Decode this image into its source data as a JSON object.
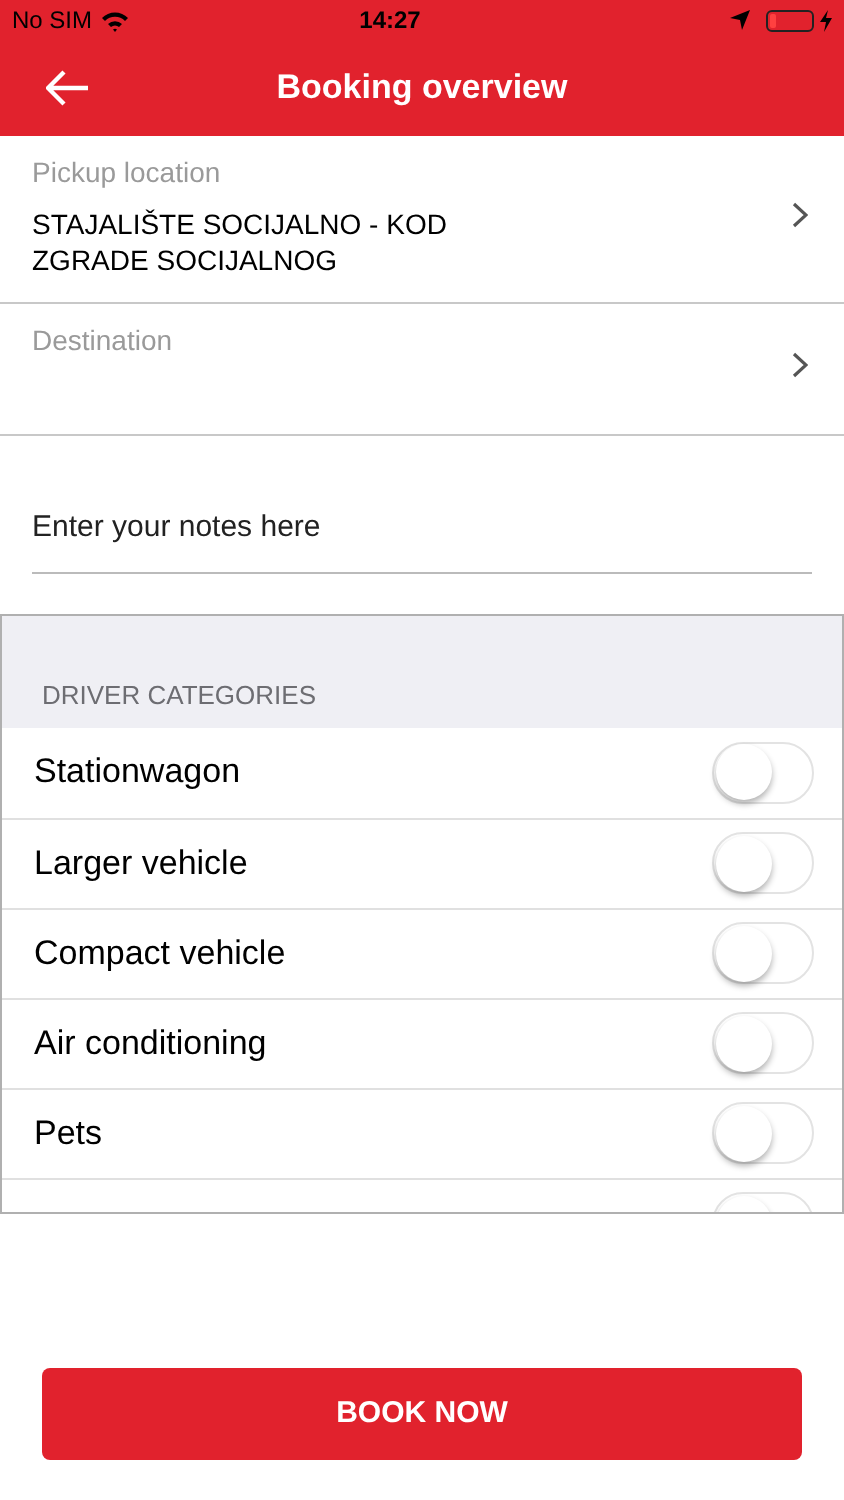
{
  "status_bar": {
    "carrier": "No SIM",
    "time": "14:27",
    "battery": {
      "level": 0.15
    }
  },
  "nav": {
    "title": "Booking overview"
  },
  "fields": [
    {
      "label": "Pickup location",
      "value": "STAJALIŠTE SOCIJALNO - KOD ZGRADE SOCIJALNOG"
    },
    {
      "label": "Destination"
    }
  ],
  "notes": {
    "placeholder": "Enter your notes here"
  },
  "categories": {
    "header": "DRIVER CATEGORIES",
    "items": [
      {
        "label": "Stationwagon",
        "on": false
      },
      {
        "label": "Larger vehicle",
        "on": false
      },
      {
        "label": "Compact vehicle",
        "on": false
      },
      {
        "label": "Air conditioning",
        "on": false
      },
      {
        "label": "Pets",
        "on": false
      },
      {
        "on": false
      }
    ]
  },
  "book_button": "BOOK NOW"
}
